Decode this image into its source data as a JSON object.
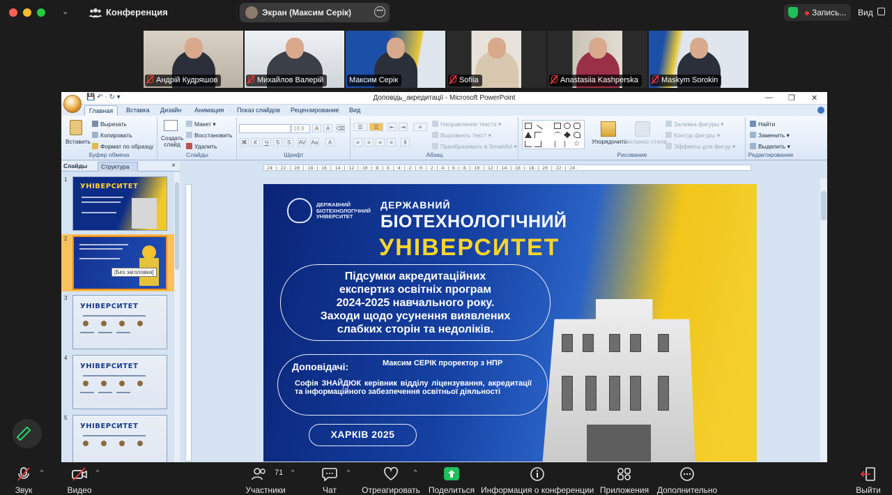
{
  "topbar": {
    "meeting_title": "Конференция",
    "shared_screen_label": "Экран (Максим Серік)",
    "record_label": "Запись...",
    "view_label": "Вид"
  },
  "participants": [
    {
      "name": "Андрій Кудряшов",
      "muted": true
    },
    {
      "name": "Михайлов Валерій",
      "muted": true
    },
    {
      "name": "Максим Серік",
      "muted": false,
      "active": true
    },
    {
      "name": "Sofiia",
      "muted": true
    },
    {
      "name": "Anastasiia Kashperska",
      "muted": true
    },
    {
      "name": "Maskym Sorokin",
      "muted": true
    }
  ],
  "ppt": {
    "quick_access": "💾 ↶ · ↻ ▾",
    "window_title": "Доповідь_акредитації - Microsoft PowerPoint",
    "tabs": [
      "Главная",
      "Вставка",
      "Дизайн",
      "Анимация",
      "Показ слайдов",
      "Рецензирование",
      "Вид"
    ],
    "clipboard": {
      "paste": "Вставить",
      "cut": "Вырезать",
      "copy": "Копировать",
      "format": "Формат по образцу",
      "label": "Буфер обмена"
    },
    "slides_group": {
      "new_slide": "Создать слайд",
      "layout": "Макет",
      "reset": "Восстановить",
      "delete": "Удалить",
      "label": "Слайды"
    },
    "font_group": {
      "size": "18,9",
      "label": "Шрифт"
    },
    "paragraph_group": {
      "direction": "Направление текста",
      "align": "Выровнять текст",
      "smartart": "Преобразовать в SmartArt",
      "label": "Абзац"
    },
    "drawing_group": {
      "arrange": "Упорядочить",
      "quick_styles": "Экспресс-стили",
      "fill": "Заливка фигуры",
      "outline": "Контур фигуры",
      "effects": "Эффекты для фигур",
      "label": "Рисование"
    },
    "editing_group": {
      "find": "Найти",
      "replace": "Заменить",
      "select": "Выделить",
      "label": "Редактирование"
    },
    "pane_tabs": {
      "slides": "Слайды",
      "outline": "Структура"
    },
    "tooltip": "[Без заголовка]",
    "thumb_numbers": [
      "1",
      "2",
      "3",
      "4",
      "5"
    ],
    "thumb_title": "УНІВЕРСИТЕТ",
    "ruler_text": "·24·|·22·|·20·|·18·|·16·|·14·|·12·|·10·|·8·|·6·|·4·|·2·|·0·|·2·|·4·|·6·|·8·|·10·|·12·|·14·|·16·|·18·|·20·|·22·|·24·"
  },
  "slide": {
    "logo_text": "ДЕРЖАВНИЙ БІОТЕХНОЛОГІЧНИЙ УНІВЕРСИТЕТ",
    "title_line1": "ДЕРЖАВНИЙ",
    "title_line2": "БІОТЕХНОЛОГІЧНИЙ",
    "title_line3": "УНІВЕРСИТЕТ",
    "box_lines": [
      "Підсумки акредитаційних",
      "експертиз освітніх програм",
      "2024-2025 навчального року.",
      "Заходи щодо усунення виявлених",
      "слабких сторін та недоліків."
    ],
    "speakers_label": "Доповідачі:",
    "speaker1": "Максим СЕРІК проректор з НПР",
    "speaker2": "Софія ЗНАЙДЮК керівник відділу ліцензування, акредитації та інформаційного забезпечення освітньої діяльності",
    "city": "ХАРКІВ 2025"
  },
  "toolbar": {
    "audio": "Звук",
    "video": "Видео",
    "participants": "Участники",
    "participants_count": "71",
    "chat": "Чат",
    "react": "Отреагировать",
    "share": "Поделиться",
    "info": "Информация о конференции",
    "apps": "Приложения",
    "more": "Дополнительно",
    "leave": "Выйти"
  },
  "colors": {
    "active_speaker": "#21b24a",
    "share_green": "#1fbf5a",
    "mute_red": "#e53935",
    "slide_yellow": "#ffd52a"
  }
}
